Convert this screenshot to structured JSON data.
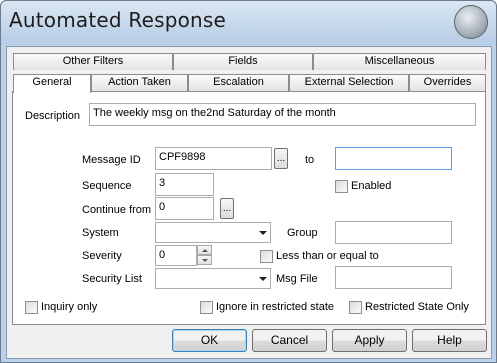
{
  "window": {
    "title": "Automated Response",
    "logo_icon": "app-logo-icon"
  },
  "tabs": {
    "back_row": [
      "Other Filters",
      "Fields",
      "Miscellaneous"
    ],
    "front_row": [
      "General",
      "Action Taken",
      "Escalation",
      "External Selection",
      "Overrides"
    ],
    "active": "General"
  },
  "form": {
    "description_label": "Description",
    "description_value": "The weekly msg on the2nd Saturday of the month",
    "message_id_label": "Message ID",
    "message_id_value": "CPF9898",
    "to_label": "to",
    "to_value": "",
    "ellipsis": "...",
    "sequence_label": "Sequence",
    "sequence_value": "3",
    "enabled_label": "Enabled",
    "continue_from_label": "Continue from",
    "continue_from_value": "0",
    "system_label": "System",
    "system_value": "",
    "group_label": "Group",
    "group_value": "",
    "severity_label": "Severity",
    "severity_value": "0",
    "less_than_label": "Less than or equal to",
    "security_list_label": "Security  List",
    "security_list_value": "",
    "msg_file_label": "Msg File",
    "msg_file_value": ""
  },
  "bottom_checks": {
    "inquiry_only": "Inquiry only",
    "ignore_restricted": "Ignore in restricted state",
    "restricted_only": "Restricted State Only"
  },
  "buttons": {
    "ok": "OK",
    "cancel": "Cancel",
    "apply": "Apply",
    "help": "Help"
  }
}
